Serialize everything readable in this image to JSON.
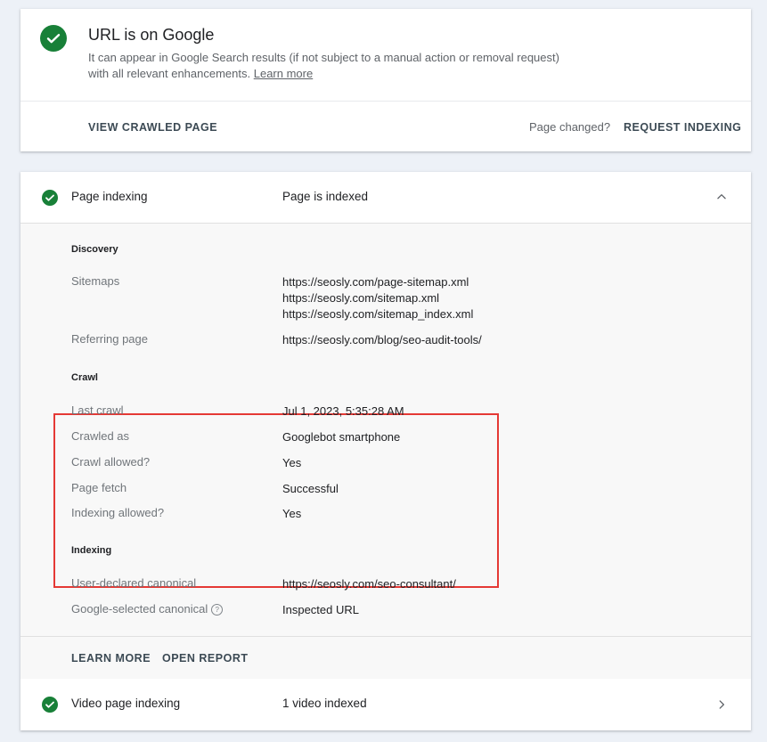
{
  "status_card": {
    "title": "URL is on Google",
    "description": "It can appear in Google Search results (if not subject to a manual action or removal request) with all relevant enhancements.",
    "learn_more_link": "Learn more",
    "view_crawled_page": "VIEW CRAWLED PAGE",
    "page_changed": "Page changed?",
    "request_indexing": "REQUEST INDEXING"
  },
  "page_indexing": {
    "label": "Page indexing",
    "status": "Page is indexed",
    "discovery": {
      "heading": "Discovery",
      "sitemaps_label": "Sitemaps",
      "sitemaps": [
        "https://seosly.com/page-sitemap.xml",
        "https://seosly.com/sitemap.xml",
        "https://seosly.com/sitemap_index.xml"
      ],
      "referring_label": "Referring page",
      "referring_value": "https://seosly.com/blog/seo-audit-tools/"
    },
    "crawl": {
      "heading": "Crawl",
      "rows": [
        {
          "key": "Last crawl",
          "value": "Jul 1, 2023, 5:35:28 AM"
        },
        {
          "key": "Crawled as",
          "value": "Googlebot smartphone"
        },
        {
          "key": "Crawl allowed?",
          "value": "Yes"
        },
        {
          "key": "Page fetch",
          "value": "Successful"
        },
        {
          "key": "Indexing allowed?",
          "value": "Yes"
        }
      ]
    },
    "indexing": {
      "heading": "Indexing",
      "user_canonical_label": "User-declared canonical",
      "user_canonical_value": "https://seosly.com/seo-consultant/",
      "google_canonical_label": "Google-selected canonical",
      "google_canonical_help": "?",
      "google_canonical_value": "Inspected URL"
    },
    "learn_more": "LEARN MORE",
    "open_report": "OPEN REPORT"
  },
  "video_indexing": {
    "label": "Video page indexing",
    "status": "1 video indexed"
  },
  "colors": {
    "success": "#188038",
    "highlight": "#e53935",
    "background": "#edf1f7"
  },
  "icons": [
    "check-circle-icon",
    "chevron-up-icon",
    "chevron-right-icon",
    "help-icon"
  ]
}
